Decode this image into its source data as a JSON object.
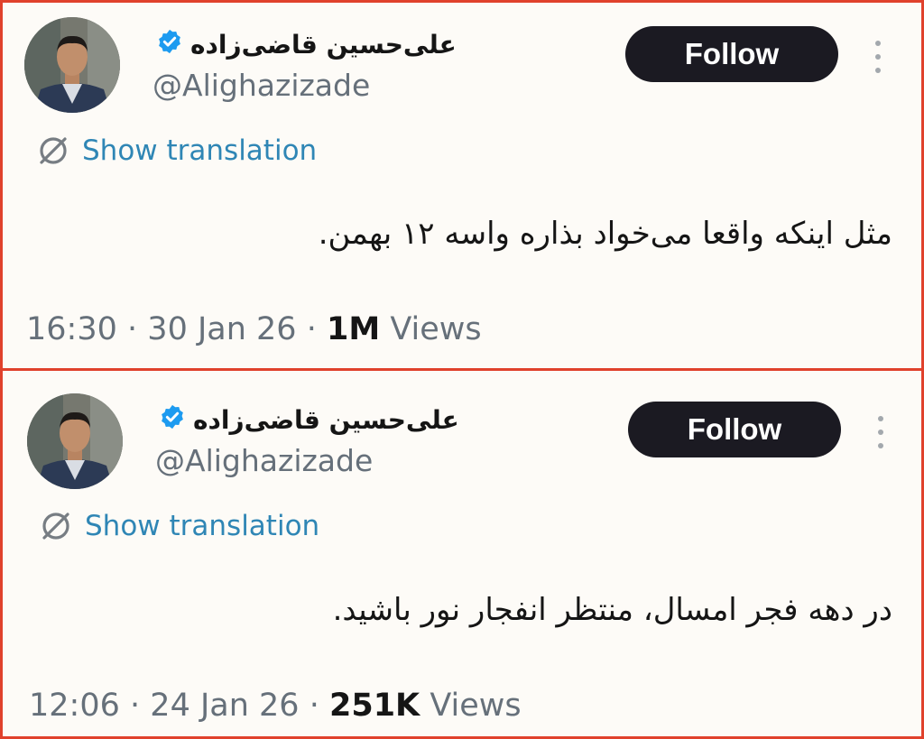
{
  "tweets": [
    {
      "author_name": "علی‌حسین قاضی‌زاده",
      "handle": "@Alighazizade",
      "follow_label": "Follow",
      "translate_label": "Show translation",
      "text": "مثل اینکه واقعا می‌خواد بذاره واسه ۱۲ بهمن.",
      "time": "16:30",
      "date": "30 Jan 26",
      "views_count": "1M",
      "views_label": "Views",
      "sep": "·"
    },
    {
      "author_name": "علی‌حسین قاضی‌زاده",
      "handle": "@Alighazizade",
      "follow_label": "Follow",
      "translate_label": "Show translation",
      "text": "در دهه فجر امسال، منتظر انفجار نور باشید.",
      "time": "12:06",
      "date": "24 Jan 26",
      "views_count": "251K",
      "views_label": "Views",
      "sep": "·"
    }
  ],
  "colors": {
    "border": "#e0412c",
    "background": "#fdfbf7",
    "follow_bg": "#1b1a22",
    "link": "#2f86b5",
    "verified": "#1d9bf0",
    "muted": "#66707a"
  },
  "icons": {
    "verified": "verified-badge-icon",
    "translate": "globe-translate-icon",
    "more": "more-vertical-icon"
  }
}
